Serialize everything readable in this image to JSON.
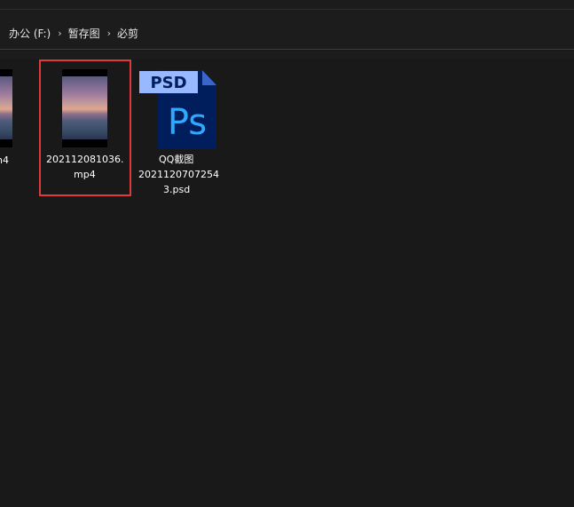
{
  "breadcrumb": {
    "items": [
      "办公 (F:)",
      "暂存图",
      "必剪"
    ],
    "separator": "›"
  },
  "files": {
    "partial": {
      "label_fragment": "n4",
      "icon": "video-thumbnail"
    },
    "selected": {
      "line1": "202112081036.",
      "line2": "mp4",
      "icon": "video-thumbnail"
    },
    "psd": {
      "line1": "QQ截图",
      "line2": "2021120707254",
      "line3": "3.psd",
      "badge": "PSD",
      "logo": "Ps",
      "icon": "photoshop-file-icon"
    }
  },
  "colors": {
    "background": "#191919",
    "selection_highlight": "#e0393b",
    "ps_blue": "#001d5c",
    "ps_text": "#31a8ff",
    "psd_tag": "#98b8ff"
  }
}
